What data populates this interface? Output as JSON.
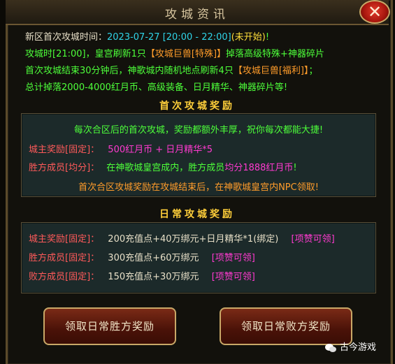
{
  "window": {
    "title": "攻城资讯"
  },
  "intro": {
    "l1_a": "新区首次攻城时间：",
    "l1_b": "2023-07-27 [20:00 - 22:00]",
    "l1_c": "(未开始)",
    "l1_d": "!",
    "l2_a": "攻城时[21:00]，皇宫刷新1只",
    "l2_b": "【攻城巨兽[特殊]】",
    "l2_c": "掉落高级特殊+神器碎片",
    "l3_a": "首次攻城结束30分钟后，神歌城内随机地点刷新4只",
    "l3_b": "【攻城巨兽[福利]】",
    "l3_c": "；",
    "l4": "总计掉落2000-4000红月币、高级装备、日月精华、神器碎片等!"
  },
  "first_section": {
    "header": "首次攻城奖励",
    "desc": "每次合区后的首次攻城，奖励都额外丰厚，祝你每次都能大捷!",
    "r1_label": "城主奖励[固定]：",
    "r1_value": "500红月币 + 日月精华*5",
    "r2_label": "胜方成员[均分]：",
    "r2_value_a": "在神歌城皇宫成内，胜方成员",
    "r2_value_b": "均分1888红月币",
    "r2_value_c": "!",
    "note": "首次合区攻城奖励在攻城结束后，在神歌城皇宫内NPC领取!"
  },
  "daily_section": {
    "header": "日常攻城奖励",
    "rows": [
      {
        "label": "城主奖励[固定]：",
        "value": "200充值点+40万绑元+日月精华*1(绑定)",
        "tag": "[项赞可领]"
      },
      {
        "label": "胜方成员[固定]：",
        "value": "300充值点+60万绑元",
        "tag": "[项赞可领]"
      },
      {
        "label": "败方成员[固定]：",
        "value": "150充值点+30万绑元",
        "tag": "[项赞可领]"
      }
    ]
  },
  "buttons": {
    "claim_win": "领取日常胜方奖励",
    "claim_lose": "领取日常败方奖励"
  },
  "watermark": {
    "text": "古今游戏",
    "icon": "wechat-icon"
  }
}
